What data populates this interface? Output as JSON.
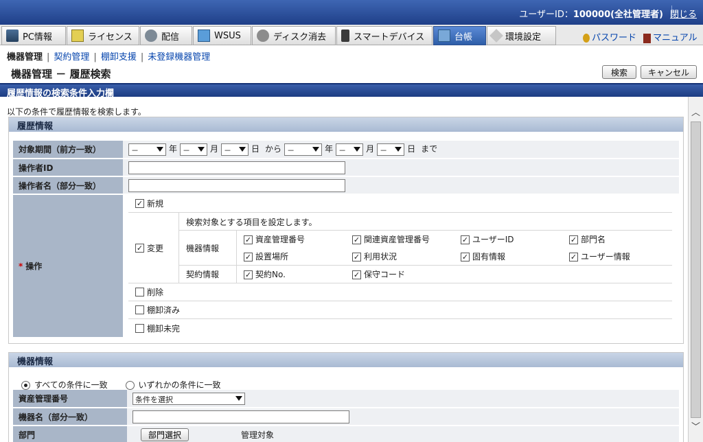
{
  "header": {
    "user_label": "ユーザーID：",
    "user_id": "100000(全社管理者)",
    "close": "閉じる"
  },
  "tabs": [
    {
      "label": "PC情報",
      "icon": "pc-icon"
    },
    {
      "label": "ライセンス",
      "icon": "license-icon"
    },
    {
      "label": "配信",
      "icon": "distribution-icon"
    },
    {
      "label": "WSUS",
      "icon": "wsus-icon"
    },
    {
      "label": "ディスク消去",
      "icon": "disk-erase-icon"
    },
    {
      "label": "スマートデバイス",
      "icon": "smart-device-icon"
    },
    {
      "label": "台帳",
      "icon": "ledger-icon"
    },
    {
      "label": "環境設定",
      "icon": "settings-tool-icon"
    }
  ],
  "links": {
    "password": "パスワード",
    "manual": "マニュアル"
  },
  "subnav": {
    "current": "機器管理",
    "contract": "契約管理",
    "inventory": "棚卸支援",
    "unregistered": "未登録機器管理"
  },
  "page": {
    "title": "機器管理 － 履歴検索",
    "search": "検索",
    "cancel": "キャンセル"
  },
  "section": {
    "title": "履歴情報の検索条件入力欄",
    "desc": "以下の条件で履歴情報を検索します。"
  },
  "history": {
    "title": "履歴情報",
    "period_label": "対象期間（前方一致）",
    "dash": "－",
    "year": "年",
    "month": "月",
    "day": "日",
    "from": "から",
    "until": "まで",
    "operator_id_label": "操作者ID",
    "operator_name_label": "操作者名（部分一致）",
    "op_required": "*",
    "op_label": "操作",
    "op_new": "新規",
    "op_change": "変更",
    "op_desc": "検索対象とする項目を設定します。",
    "group_device": "機器情報",
    "group_contract": "契約情報",
    "device_items": [
      "資産管理番号",
      "関連資産管理番号",
      "ユーザーID",
      "部門名",
      "設置場所",
      "利用状況",
      "固有情報",
      "ユーザー情報"
    ],
    "contract_items": [
      "契約No.",
      "保守コード"
    ],
    "op_delete": "削除",
    "op_inventoried": "棚卸済み",
    "op_not_inventoried": "棚卸未完",
    "checked_mark": "✓"
  },
  "device": {
    "title": "機器情報",
    "match_all": "すべての条件に一致",
    "match_any": "いずれかの条件に一致",
    "asset_label": "資産管理番号",
    "asset_select": "条件を選択",
    "name_label": "機器名（部分一致）",
    "dept_label": "部門",
    "dept_button": "部門選択",
    "target_label": "管理対象"
  }
}
